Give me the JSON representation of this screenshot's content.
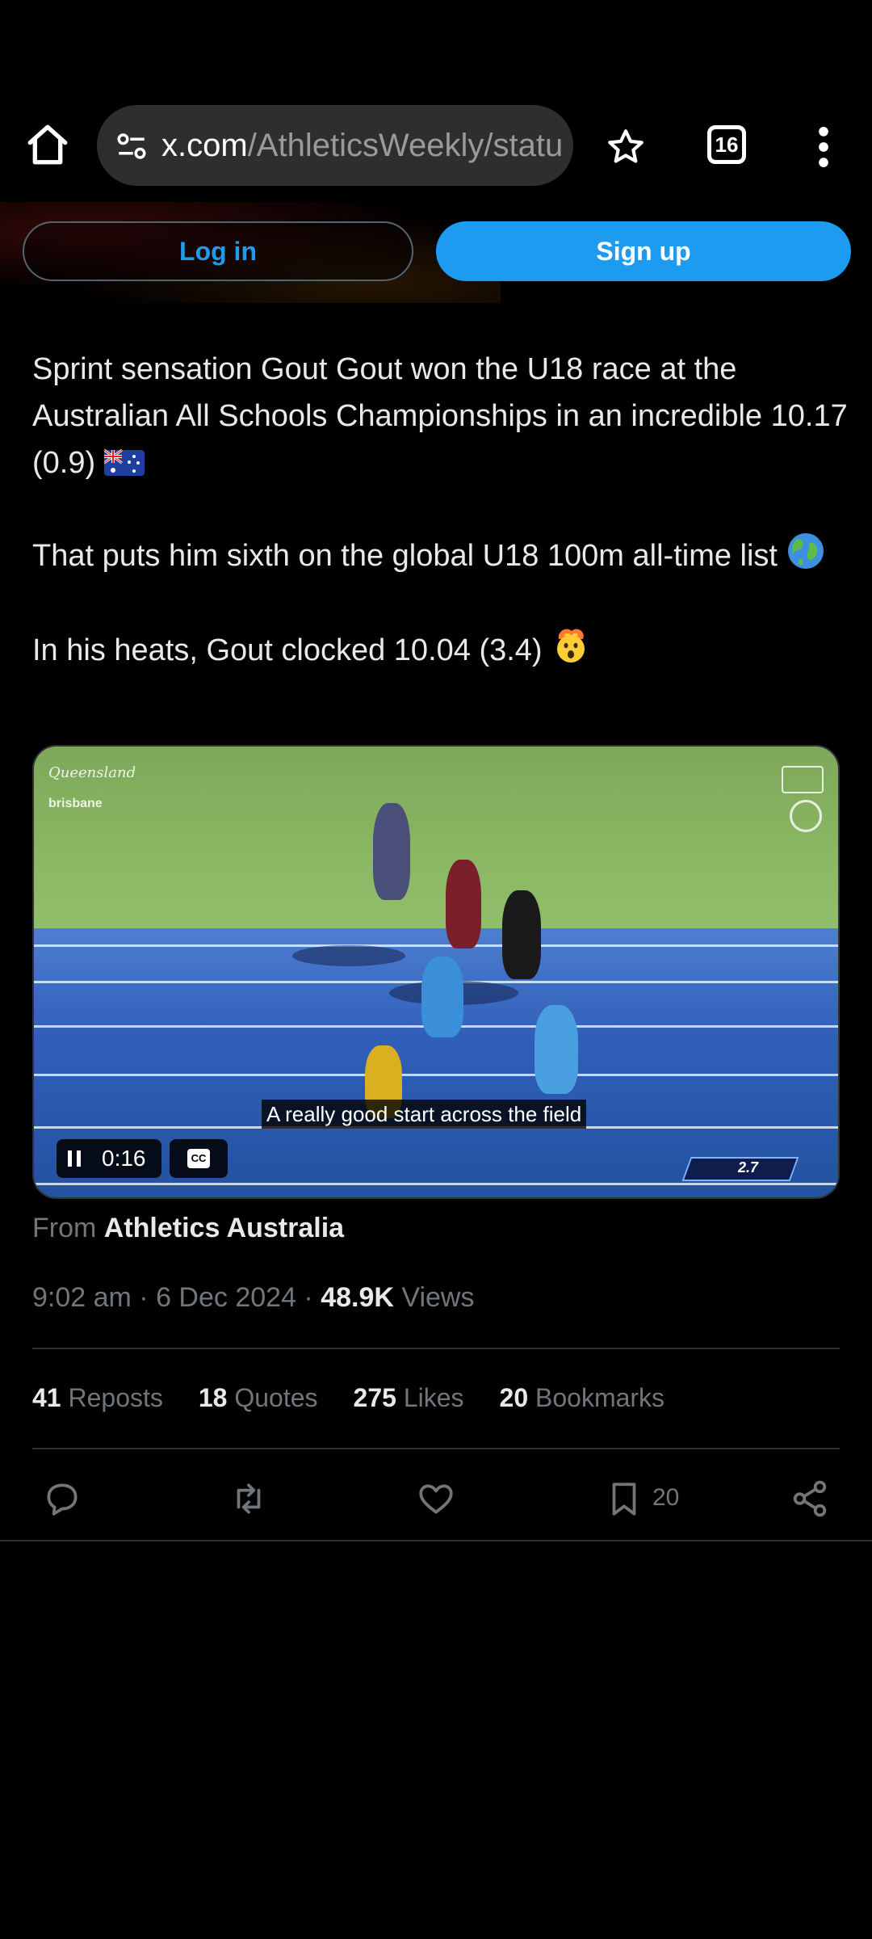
{
  "browser": {
    "url_host": "x.com",
    "url_path": "/AthleticsWeekly/statu",
    "tab_count": "16",
    "icons": [
      "home-icon",
      "page-info-icon",
      "star-icon",
      "tabs-icon",
      "more-vert-icon"
    ]
  },
  "auth": {
    "login_label": "Log in",
    "signup_label": "Sign up"
  },
  "tweet": {
    "para1": "Sprint sensation Gout Gout won the U18 race at the Australian All Schools Championships in an incredible 10.17 (0.9)",
    "para2": "That puts him sixth on the global U18 100m all-time list",
    "para3": "In his heats, Gout clocked 10.04 (3.4)",
    "emojis": [
      "australia-flag-icon",
      "globe-icon",
      "exploding-head-icon"
    ]
  },
  "video": {
    "caption": "A really good start across the field",
    "time": "0:16",
    "cc_label": "CC",
    "wind_reading": "2.7",
    "logo_left_1": "Queensland",
    "logo_left_2": "brisbane"
  },
  "source": {
    "prefix": "From",
    "name": "Athletics Australia"
  },
  "meta": {
    "time": "9:02 am",
    "sep1": " · ",
    "date": "6 Dec 2024",
    "sep2": " · ",
    "views_count": "48.9K",
    "views_label": " Views"
  },
  "stats": {
    "reposts_count": "41",
    "reposts_label": " Reposts",
    "quotes_count": "18",
    "quotes_label": " Quotes",
    "likes_count": "275",
    "likes_label": " Likes",
    "bookmarks_count": "20",
    "bookmarks_label": " Bookmarks"
  },
  "actions": {
    "bookmark_count": "20",
    "icons": [
      "reply-icon",
      "repost-icon",
      "like-icon",
      "bookmark-icon",
      "share-icon"
    ]
  },
  "colors": {
    "accent": "#1d9bf0",
    "background": "#000000",
    "muted": "#71767b",
    "text": "#e7e9ea"
  }
}
